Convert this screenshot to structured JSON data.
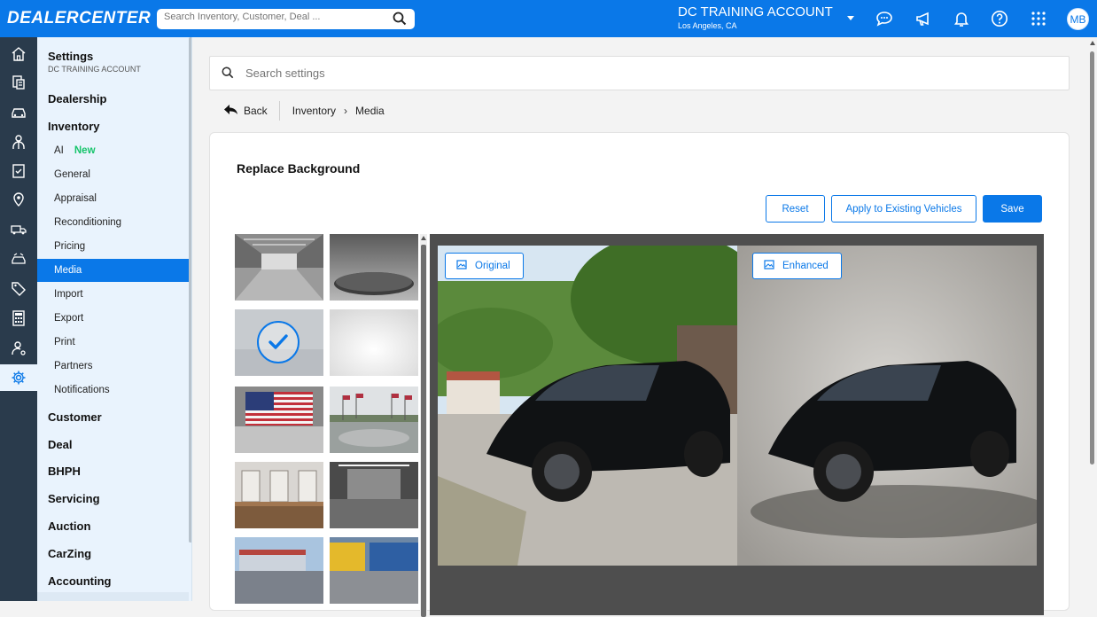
{
  "topbar": {
    "brand": "DEALERCENTER",
    "search_placeholder": "Search Inventory, Customer, Deal ...",
    "account_name": "DC TRAINING ACCOUNT",
    "account_location": "Los Angeles, CA",
    "user_initials": "MB",
    "icons": [
      "chat-icon",
      "megaphone-icon",
      "bell-icon",
      "help-icon",
      "apps-grid-icon"
    ],
    "brand_color": "#0a78e8"
  },
  "rail": {
    "icons": [
      "home-icon",
      "inventory-icon",
      "car-icon",
      "people-icon",
      "checklist-icon",
      "location-icon",
      "truck-icon",
      "car-transfer-icon",
      "tag-icon",
      "calculator-icon",
      "user-settings-icon",
      "gear-icon"
    ],
    "active": "gear-icon"
  },
  "nav": {
    "title": "Settings",
    "subtitle": "DC TRAINING ACCOUNT",
    "sections_top": [
      "Dealership",
      "Inventory"
    ],
    "inventory_items": [
      {
        "label": "AI",
        "badge": "New"
      },
      {
        "label": "General"
      },
      {
        "label": "Appraisal"
      },
      {
        "label": "Reconditioning"
      },
      {
        "label": "Pricing"
      },
      {
        "label": "Media"
      },
      {
        "label": "Import"
      },
      {
        "label": "Export"
      },
      {
        "label": "Print"
      },
      {
        "label": "Partners"
      },
      {
        "label": "Notifications"
      }
    ],
    "active_item": "Media",
    "sections_bottom": [
      "Customer",
      "Deal",
      "BHPH",
      "Servicing",
      "Auction",
      "CarZing",
      "Accounting"
    ]
  },
  "settings_search": {
    "placeholder": "Search settings"
  },
  "breadcrumb": {
    "back_label": "Back",
    "items": [
      "Inventory",
      "Media"
    ]
  },
  "card": {
    "title": "Replace Background",
    "buttons": {
      "reset": "Reset",
      "apply": "Apply to Existing Vehicles",
      "save": "Save"
    },
    "backgrounds": [
      {
        "name": "warehouse"
      },
      {
        "name": "studio-turntable"
      },
      {
        "name": "light-studio",
        "selected": true
      },
      {
        "name": "white-studio"
      },
      {
        "name": "flag-wall"
      },
      {
        "name": "flag-plaza"
      },
      {
        "name": "marble-showroom"
      },
      {
        "name": "dark-showroom"
      },
      {
        "name": "dealership-exterior"
      },
      {
        "name": "colorful-showroom"
      }
    ],
    "compare": {
      "original_label": "Original",
      "enhanced_label": "Enhanced"
    }
  }
}
